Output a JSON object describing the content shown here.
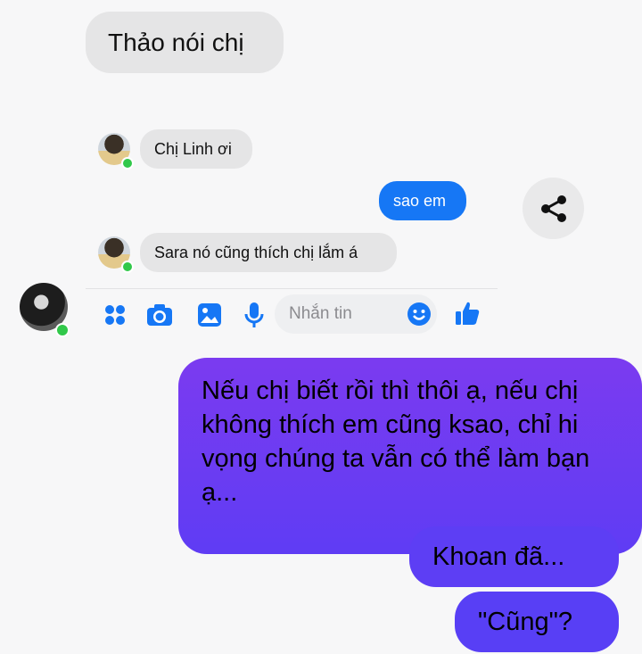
{
  "messages": {
    "top": "Thảo nói chị",
    "incoming_1": "Chị Linh ơi",
    "outgoing_1": "sao em",
    "incoming_2": "Sara nó cũng thích chị lắm á",
    "long_outgoing": "Nếu chị biết rồi thì thôi ạ, nếu chị không thích em cũng ksao, chỉ hi vọng chúng ta vẫn có thể làm bạn ạ...",
    "outgoing_2": "Khoan đã...",
    "outgoing_3": "\"Cũng\"?"
  },
  "composer": {
    "placeholder": "Nhắn tin"
  },
  "icons": [
    "apps-icon",
    "camera-icon",
    "image-icon",
    "mic-icon",
    "emoji-icon",
    "like-icon",
    "share-icon"
  ],
  "colors": {
    "messenger_blue": "#1677f5",
    "purple": "#5d3ef4",
    "online": "#31c84a",
    "bubble_grey": "#e5e5e6"
  }
}
